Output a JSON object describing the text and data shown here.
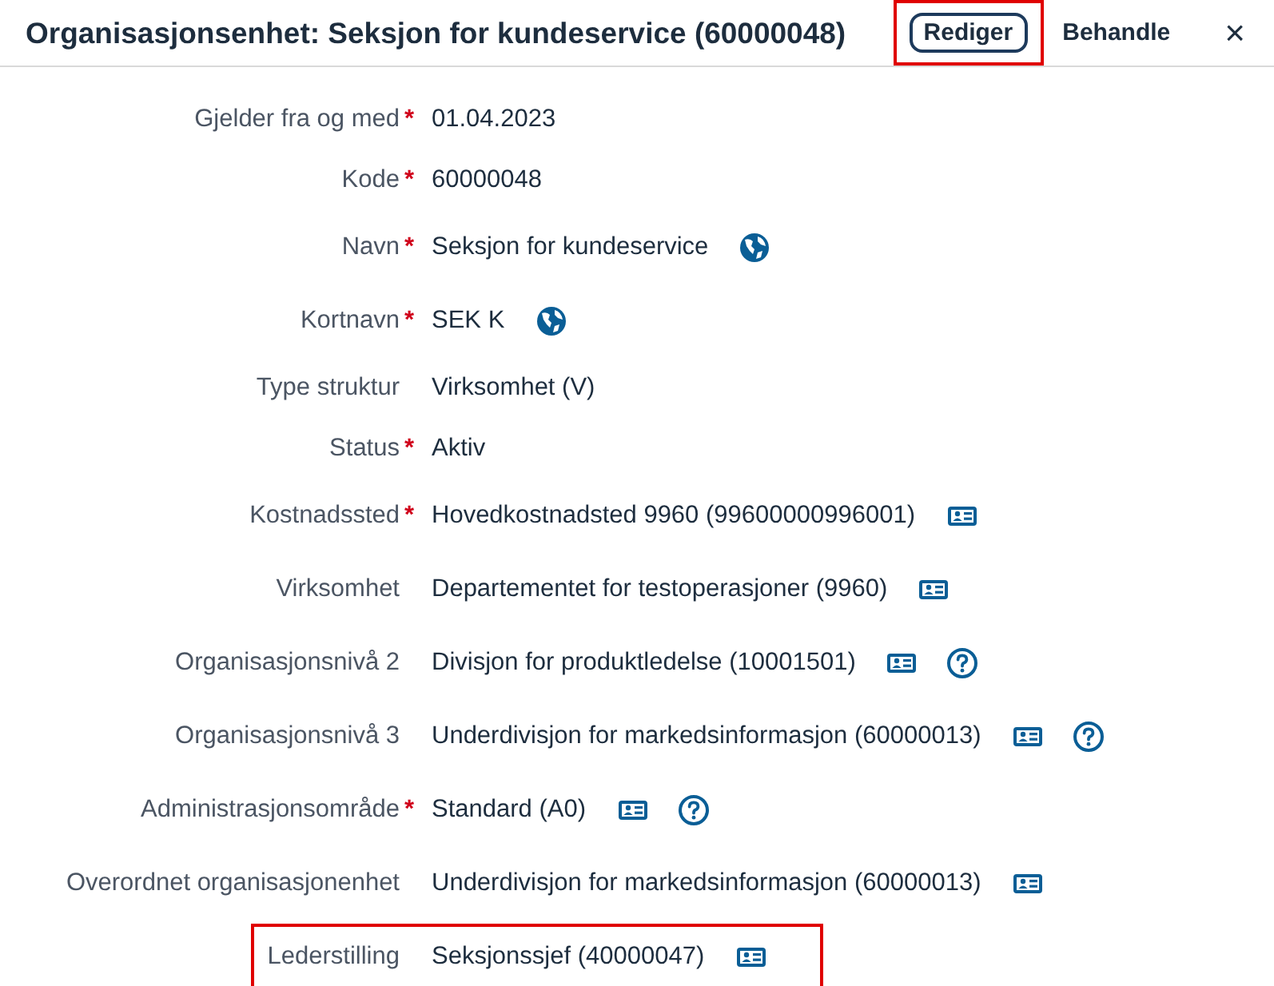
{
  "header": {
    "title": "Organisasjonsenhet: Seksjon for kundeservice (60000048)",
    "actions": [
      {
        "label": "Rediger",
        "kind": "outlined",
        "highlighted": true
      },
      {
        "label": "Behandle",
        "kind": "plain",
        "highlighted": false
      }
    ],
    "close": "×"
  },
  "fields": [
    {
      "label": "Gjelder fra og med",
      "required_mark": "*",
      "value": "01.04.2023",
      "highlighted": false
    },
    {
      "label": "Kode",
      "required_mark": "*",
      "value": "60000048",
      "highlighted": false
    },
    {
      "label": "Navn",
      "required_mark": "*",
      "value": "Seksjon for kundeservice",
      "icons": [
        {
          "kind": "globe"
        }
      ],
      "highlighted": false
    },
    {
      "label": "Kortnavn",
      "required_mark": "*",
      "value": "SEK K",
      "icons": [
        {
          "kind": "globe"
        }
      ],
      "highlighted": false
    },
    {
      "label": "Type struktur",
      "value": "Virksomhet (V)",
      "highlighted": false
    },
    {
      "label": "Status",
      "required_mark": "*",
      "value": "Aktiv",
      "highlighted": false
    },
    {
      "label": "Kostnadssted",
      "required_mark": "*",
      "value": "Hovedkostnadsted 9960 (99600000996001)",
      "icons": [
        {
          "kind": "card"
        }
      ],
      "highlighted": false
    },
    {
      "label": "Virksomhet",
      "value": "Departementet for testoperasjoner (9960)",
      "icons": [
        {
          "kind": "card"
        }
      ],
      "highlighted": false
    },
    {
      "label": "Organisasjonsnivå 2",
      "value": "Divisjon for produktledelse (10001501)",
      "icons": [
        {
          "kind": "card"
        },
        {
          "kind": "help"
        }
      ],
      "highlighted": false
    },
    {
      "label": "Organisasjonsnivå 3",
      "value": "Underdivisjon for markedsinformasjon (60000013)",
      "icons": [
        {
          "kind": "card"
        },
        {
          "kind": "help"
        }
      ],
      "highlighted": false
    },
    {
      "label": "Administrasjonsområde",
      "required_mark": "*",
      "value": "Standard (A0)",
      "icons": [
        {
          "kind": "card"
        },
        {
          "kind": "help"
        }
      ],
      "highlighted": false
    },
    {
      "label": "Overordnet organisasjonenhet",
      "value": "Underdivisjon for markedsinformasjon (60000013)",
      "icons": [
        {
          "kind": "card"
        }
      ],
      "highlighted": false
    },
    {
      "label": "Lederstilling",
      "value": "Seksjonssjef (40000047)",
      "icons": [
        {
          "kind": "card"
        }
      ],
      "highlighted": true
    }
  ]
}
